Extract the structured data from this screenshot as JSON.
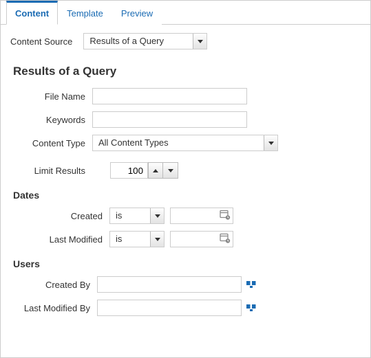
{
  "tabs": {
    "content": "Content",
    "template": "Template",
    "preview": "Preview"
  },
  "content_source": {
    "label": "Content Source",
    "value": "Results of a Query"
  },
  "query": {
    "heading": "Results of a Query",
    "file_name": {
      "label": "File Name",
      "value": ""
    },
    "keywords": {
      "label": "Keywords",
      "value": ""
    },
    "content_type": {
      "label": "Content Type",
      "value": "All Content Types"
    },
    "limit_results": {
      "label": "Limit Results",
      "value": "100"
    }
  },
  "dates": {
    "heading": "Dates",
    "created": {
      "label": "Created",
      "op": "is",
      "value": ""
    },
    "last_modified": {
      "label": "Last Modified",
      "op": "is",
      "value": ""
    }
  },
  "users": {
    "heading": "Users",
    "created_by": {
      "label": "Created By",
      "value": ""
    },
    "last_modified_by": {
      "label": "Last Modified By",
      "value": ""
    }
  }
}
